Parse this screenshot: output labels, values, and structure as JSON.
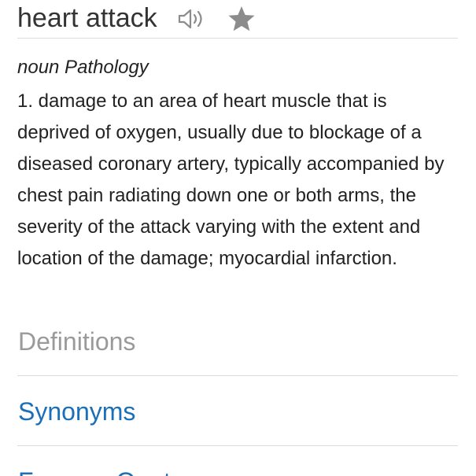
{
  "entry": {
    "word": "heart attack",
    "icons": {
      "audio": "speaker-icon",
      "favorite": "star-icon"
    },
    "part_of_speech": "noun Pathology",
    "definition": "1. damage to an area of heart muscle that is deprived of oxygen, usually due to blockage of a diseased coronary artery, typically accompanied by chest pain radiating down one or both arms, the severity of the attack varying with the extent and location of the damage; myocardial infarction."
  },
  "nav": {
    "definitions": "Definitions",
    "synonyms": "Synonyms",
    "quotes": "Famous Quotes"
  },
  "colors": {
    "text": "#222222",
    "muted": "#9a9a9a",
    "link": "#1a6fb8",
    "icon": "#8c8c8c",
    "divider": "#dcdcdc"
  }
}
